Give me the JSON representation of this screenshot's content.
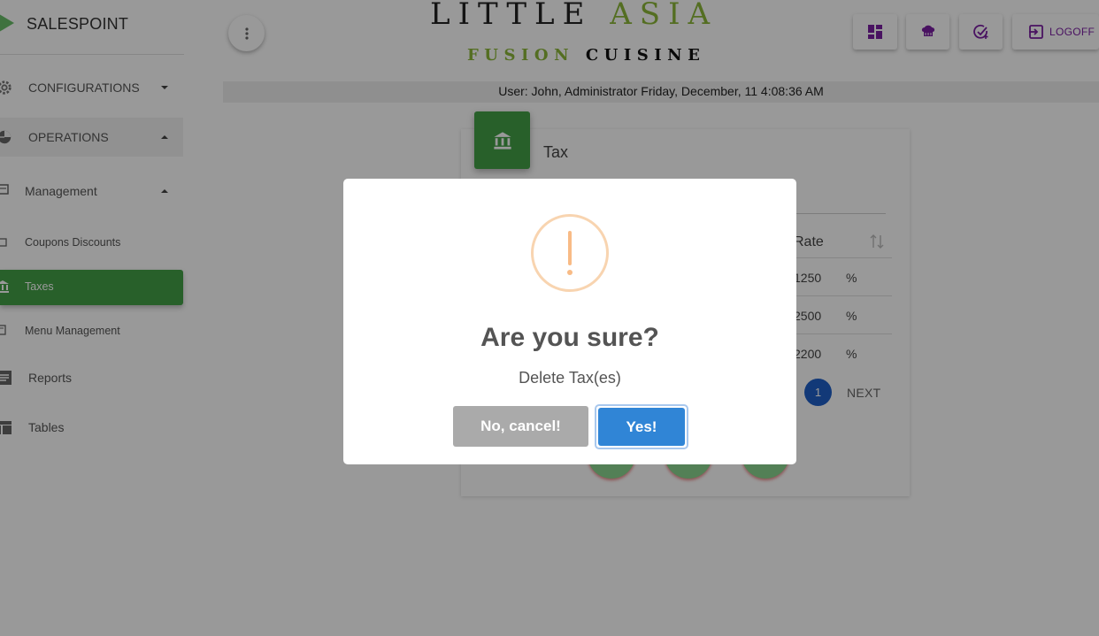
{
  "sidebar": {
    "brand": "SALESPOINT",
    "items": [
      {
        "label": "CONFIGURATIONS",
        "icon": "gear-icon"
      },
      {
        "label": "OPERATIONS",
        "icon": "pie-chart-icon"
      },
      {
        "label": "Management",
        "icon": "document-icon"
      },
      {
        "label": "Coupons Discounts",
        "icon": "coupon-icon"
      },
      {
        "label": "Taxes",
        "icon": "bank-icon"
      },
      {
        "label": "Menu Management",
        "icon": "book-icon"
      },
      {
        "label": "Reports",
        "icon": "list-icon"
      },
      {
        "label": "Tables",
        "icon": "table-icon"
      }
    ]
  },
  "header": {
    "logo_word1": "LITTLE",
    "logo_word2": "ASIA",
    "logo_sub1": "FUSION",
    "logo_sub2": "CUISINE",
    "logoff_label": "LOGOFF",
    "status": "User: John, Administrator Friday, December, 11 4:08:36 AM"
  },
  "card": {
    "title": "Tax",
    "column_header": "Rate",
    "rows": [
      {
        "rate": "1250",
        "unit": "%"
      },
      {
        "rate": "2500",
        "unit": "%"
      },
      {
        "rate": "2200",
        "unit": "%"
      }
    ],
    "current_page": "1",
    "next_label": "NEXT"
  },
  "dialog": {
    "title": "Are you sure?",
    "text": "Delete Tax(es)",
    "cancel_label": "No, cancel!",
    "confirm_label": "Yes!"
  },
  "colors": {
    "accent_green": "#43a047",
    "logo_green": "#8cb83a",
    "header_icon_purple": "#7b1fa2",
    "confirm_blue": "#3085d6",
    "cancel_gray": "#aaaaaa",
    "warning_orange": "#f8bb86"
  }
}
